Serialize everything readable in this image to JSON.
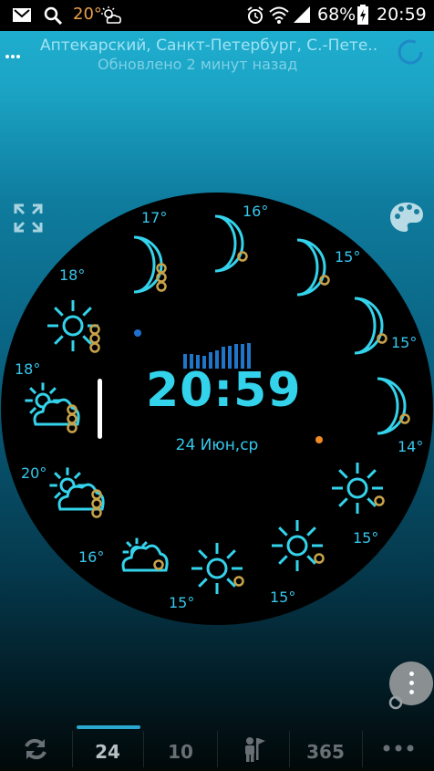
{
  "status_bar": {
    "temperature": "20°",
    "battery": "68%",
    "time": "20:59",
    "icons": [
      "gmail-icon",
      "search-icon",
      "weather-icon",
      "alarm-icon",
      "wifi-icon",
      "signal-icon",
      "battery-icon"
    ]
  },
  "header": {
    "location": "Аптекарский, Санкт-Петербург, С.-Пете..",
    "updated": "Обновлено 2 минут назад"
  },
  "clock": {
    "time": "20:59",
    "date": "24 Июн,ср"
  },
  "hourly": {
    "temps": [
      "16°",
      "15°",
      "15°",
      "14°",
      "15°",
      "15°",
      "15°",
      "16°",
      "20°",
      "18°",
      "18°",
      "17°"
    ],
    "icons": [
      "moon-icon",
      "moon-icon",
      "moon-icon",
      "moon-icon",
      "sun-icon",
      "sun-icon",
      "sun-icon",
      "cloud-icon",
      "partly-cloudy-icon",
      "partly-cloudy-icon",
      "sun-icon",
      "moon-icon"
    ]
  },
  "bottom_nav": {
    "tabs": [
      {
        "label": "",
        "icon": "refresh-icon"
      },
      {
        "label": "24"
      },
      {
        "label": "10"
      },
      {
        "label": "",
        "icon": "person-flag-icon"
      },
      {
        "label": "365"
      },
      {
        "label": "",
        "icon": "more-icon"
      }
    ]
  },
  "colors": {
    "accent": "#34d3ec",
    "background_top": "#21b3d4",
    "face": "#000000",
    "rain_drop": "#c8a24a"
  }
}
